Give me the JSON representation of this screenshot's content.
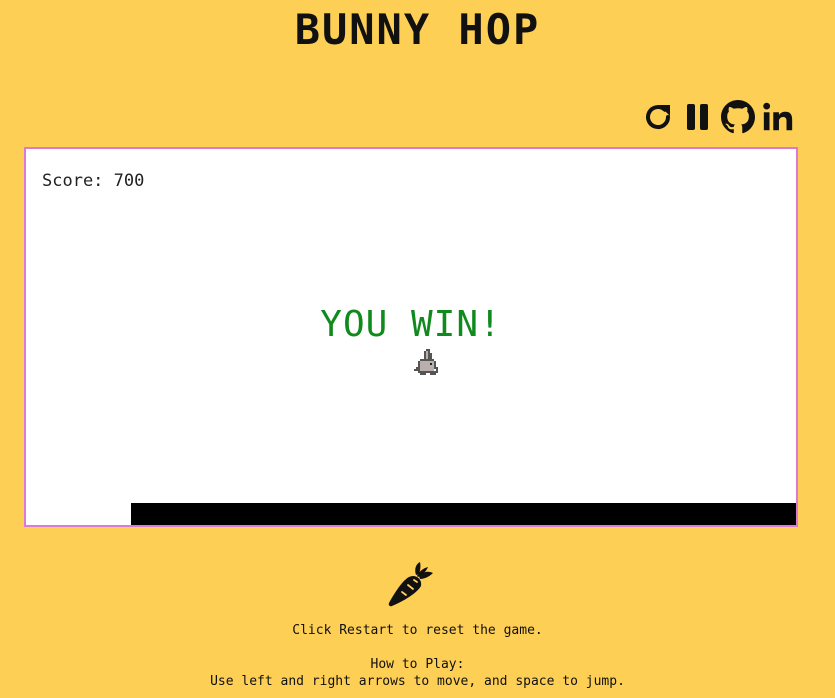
{
  "app": {
    "title": "BUNNY HOP"
  },
  "toolbar": {
    "restart_icon": "restart-icon",
    "pause_icon": "pause-icon",
    "github_icon": "github-icon",
    "linkedin_icon": "linkedin-icon",
    "linkedin_text": "in"
  },
  "game": {
    "score_label": "Score: 700",
    "win_message": "YOU WIN!",
    "status_color": "#118a1d",
    "border_color": "#da7ad6",
    "background": "#ffffff",
    "ground_color": "#000000"
  },
  "footer": {
    "carrot_icon": "carrot-icon",
    "restart_hint": "Click Restart to reset the game.",
    "howto_title": "How to Play:",
    "howto_text": "Use left and right arrows to move, and space to jump."
  },
  "colors": {
    "page_background": "#fecf55",
    "text": "#111111"
  }
}
